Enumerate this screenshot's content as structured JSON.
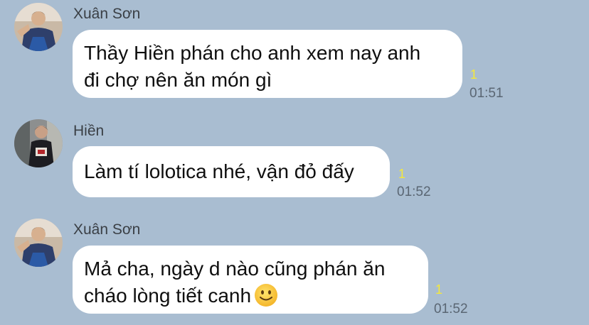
{
  "messages": [
    {
      "sender": "Xuân Sơn",
      "lines": [
        "Thầy Hiền phán cho anh xem nay anh",
        "đi chợ nên ăn món gì"
      ],
      "read_count": "1",
      "time": "01:51"
    },
    {
      "sender": "Hiền",
      "lines": [
        "Làm tí lolotica nhé, vận đỏ đấy"
      ],
      "read_count": "1",
      "time": "01:52"
    },
    {
      "sender": "Xuân Sơn",
      "lines": [
        "Mả cha, ngày d nào cũng phán ăn",
        "cháo lòng tiết canh"
      ],
      "emoji": "slightly-smiling-face-icon",
      "read_count": "1",
      "time": "01:52"
    }
  ],
  "colors": {
    "background": "#a9bdd1",
    "bubble": "#ffffff",
    "read_indicator": "#f5e83a",
    "timestamp": "#5a6673"
  }
}
